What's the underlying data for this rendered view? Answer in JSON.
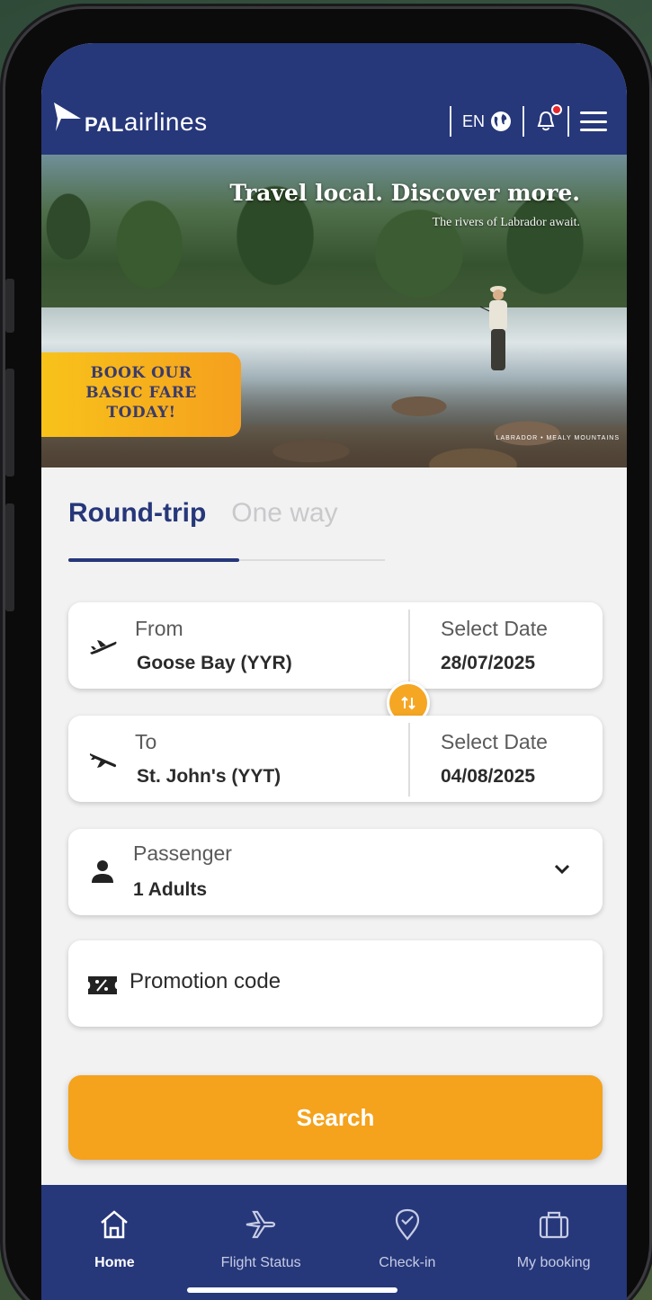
{
  "header": {
    "logo_pal": "PAL",
    "logo_airlines": "airlines",
    "language": "EN",
    "icons": [
      "globe-icon",
      "bell-icon",
      "menu-icon"
    ]
  },
  "banner": {
    "title": "Travel local. Discover more.",
    "subtitle": "The rivers of Labrador await.",
    "badge_lines": [
      "BOOK OUR",
      "BASIC FARE",
      "TODAY!"
    ],
    "credit": "LABRADOR • MEALY MOUNTAINS"
  },
  "trip_tabs": {
    "round_trip": "Round-trip",
    "one_way": "One way",
    "selected": "Round-trip"
  },
  "from": {
    "label": "From",
    "value": "Goose Bay (YYR)",
    "date_label": "Select Date",
    "date_value": "28/07/2025"
  },
  "to": {
    "label": "To",
    "value": "St. John's (YYT)",
    "date_label": "Select Date",
    "date_value": "04/08/2025"
  },
  "passenger": {
    "label": "Passenger",
    "value": "1 Adults"
  },
  "promo": {
    "placeholder": "Promotion code"
  },
  "search_label": "Search",
  "bottom_nav": [
    {
      "label": "Home",
      "icon": "home-icon",
      "active": true
    },
    {
      "label": "Flight Status",
      "icon": "airplane-icon",
      "active": false
    },
    {
      "label": "Check-in",
      "icon": "location-check-icon",
      "active": false
    },
    {
      "label": "My booking",
      "icon": "briefcase-icon",
      "active": false
    }
  ],
  "colors": {
    "brand_navy": "#26377a",
    "accent_orange": "#f5a21c",
    "notification_red": "#e7262e"
  }
}
